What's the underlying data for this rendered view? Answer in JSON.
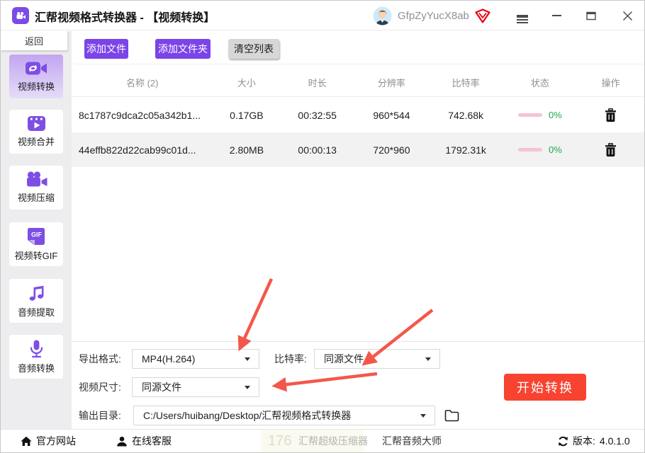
{
  "window": {
    "title": "汇帮视频格式转换器  - 【视频转换】",
    "user": "GfpZyYucX8ab"
  },
  "sidebar": {
    "back_label": "返回",
    "items": [
      {
        "label": "视频转换",
        "icon": "video-convert-icon",
        "selected": true
      },
      {
        "label": "视频合并",
        "icon": "video-merge-icon",
        "selected": false
      },
      {
        "label": "视频压缩",
        "icon": "video-compress-icon",
        "selected": false
      },
      {
        "label": "视频转GIF",
        "icon": "video-to-gif-icon",
        "selected": false
      },
      {
        "label": "音频提取",
        "icon": "audio-extract-icon",
        "selected": false
      },
      {
        "label": "音频转换",
        "icon": "audio-convert-icon",
        "selected": false
      }
    ]
  },
  "toolbar": {
    "add_file": "添加文件",
    "add_folder": "添加文件夹",
    "clear_list": "清空列表"
  },
  "table": {
    "headers": [
      "名称 (2)",
      "大小",
      "时长",
      "分辨率",
      "比特率",
      "状态",
      "操作"
    ],
    "rows": [
      {
        "name": "8c1787c9dca2c05a342b1...",
        "size": "0.17GB",
        "duration": "00:32:55",
        "resolution": "960*544",
        "bitrate": "742.68k",
        "progress": "0%"
      },
      {
        "name": "44effb822d22cab99c01d...",
        "size": "2.80MB",
        "duration": "00:00:13",
        "resolution": "720*960",
        "bitrate": "1792.31k",
        "progress": "0%"
      }
    ]
  },
  "settings": {
    "export_format_label": "导出格式:",
    "export_format_value": "MP4(H.264)",
    "bitrate_label": "比特率:",
    "bitrate_value": "同源文件",
    "video_size_label": "视频尺寸:",
    "video_size_value": "同源文件",
    "output_dir_label": "输出目录:",
    "output_dir_value": "C:/Users/huibang/Desktop/汇帮视频格式转换器",
    "start_button": "开始转换"
  },
  "statusbar": {
    "official_site": "官方网站",
    "online_service": "在线客服",
    "watermark": "176",
    "super_compressor": "汇帮超级压缩器",
    "audio_master": "汇帮音频大师",
    "version_label": "版本:",
    "version_value": "4.0.1.0"
  },
  "colors": {
    "accent_purple": "#7b44e9",
    "sidebar_selected_top": "#c2a5f0",
    "start_red": "#f84331",
    "arrow_red": "#f4574a",
    "progress_pink": "#f6c3d3",
    "progress_green": "#1ea84e",
    "vip_red": "#e60012"
  }
}
